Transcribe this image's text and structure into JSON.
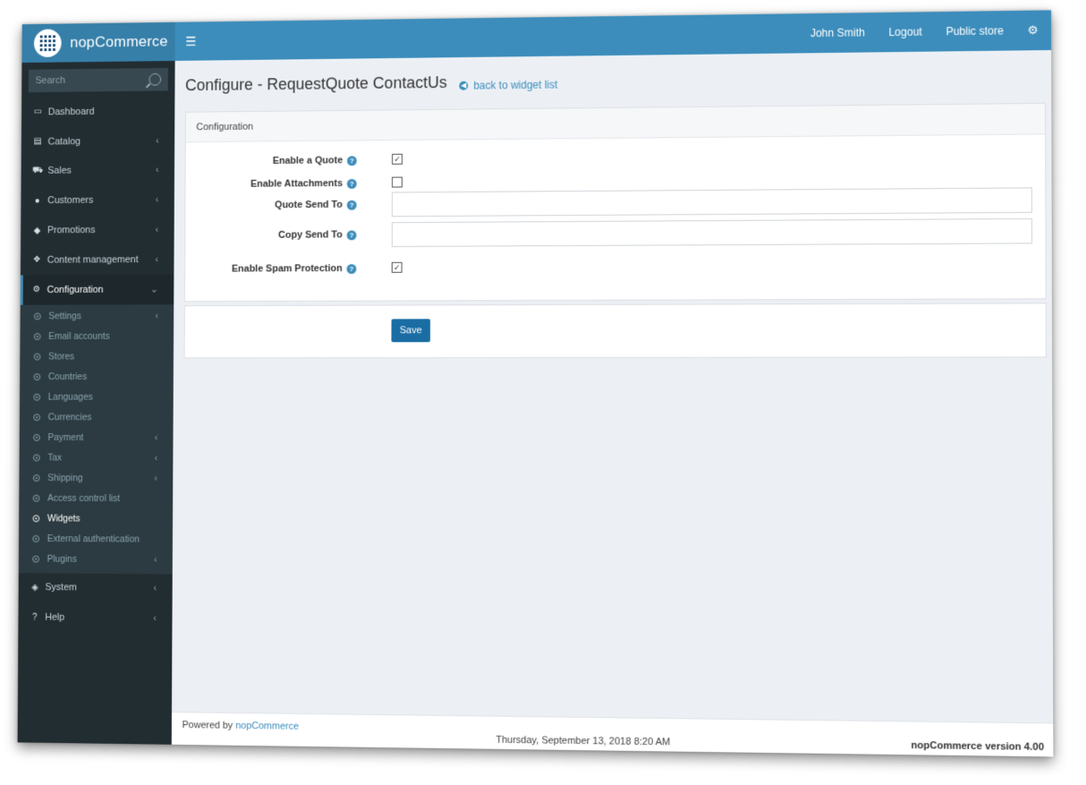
{
  "app": {
    "name": "nopCommerce"
  },
  "sidebar": {
    "search_placeholder": "Search",
    "items": [
      {
        "label": "Dashboard",
        "icon": "monitor-icon",
        "glyph": "▭"
      },
      {
        "label": "Catalog",
        "icon": "book-icon",
        "glyph": "▤"
      },
      {
        "label": "Sales",
        "icon": "cart-icon",
        "glyph": "⛟"
      },
      {
        "label": "Customers",
        "icon": "user-icon",
        "glyph": "●"
      },
      {
        "label": "Promotions",
        "icon": "tags-icon",
        "glyph": "◆"
      },
      {
        "label": "Content management",
        "icon": "cubes-icon",
        "glyph": "❖"
      },
      {
        "label": "Configuration",
        "icon": "gears-icon",
        "glyph": "⚙"
      },
      {
        "label": "System",
        "icon": "cube-icon",
        "glyph": "◈"
      },
      {
        "label": "Help",
        "icon": "question-icon",
        "glyph": "?"
      }
    ],
    "config_sub": [
      "Settings",
      "Email accounts",
      "Stores",
      "Countries",
      "Languages",
      "Currencies",
      "Payment",
      "Tax",
      "Shipping",
      "Access control list",
      "Widgets",
      "External authentication",
      "Plugins"
    ]
  },
  "header": {
    "user": "John Smith",
    "logout": "Logout",
    "public_store": "Public store"
  },
  "page": {
    "title": "Configure - RequestQuote ContactUs",
    "back_link": "back to widget list",
    "panel_title": "Configuration",
    "fields": {
      "enable_quote": {
        "label": "Enable a Quote",
        "checked": true
      },
      "enable_attachments": {
        "label": "Enable Attachments",
        "checked": false
      },
      "quote_send_to": {
        "label": "Quote Send To",
        "value": ""
      },
      "copy_send_to": {
        "label": "Copy Send To",
        "value": ""
      },
      "enable_spam": {
        "label": "Enable Spam Protection",
        "checked": true
      }
    },
    "save_label": "Save"
  },
  "footer": {
    "powered_prefix": "Powered by",
    "powered_link": "nopCommerce",
    "date": "Thursday, September 13, 2018 8:20 AM",
    "version": "nopCommerce version 4.00"
  },
  "colors": {
    "header": "#3c8dbc",
    "sidebar": "#222d32",
    "accent": "#1a6da3"
  }
}
